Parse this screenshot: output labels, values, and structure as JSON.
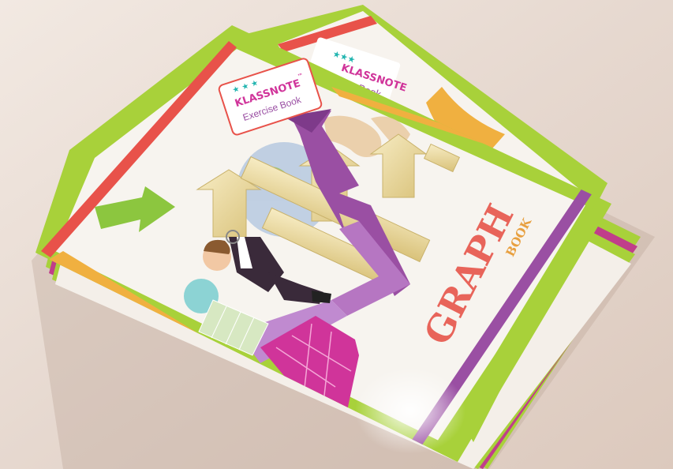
{
  "cover": {
    "brand": "KLASSNOTE",
    "brand_tm": "™",
    "product_line": "Exercise Book",
    "title": "GRAPH",
    "subtitle": "BOOK",
    "back_brand": "KLASSNOTE",
    "back_product_line": "Book"
  },
  "colors": {
    "table": "#e8ddd6",
    "lime": "#a8d13a",
    "red_stripe": "#e8524a",
    "orange": "#f0b040",
    "purple": "#9a4fa3",
    "magenta": "#d0349a",
    "title_red": "#e8645a",
    "title_gold": "#e8a040",
    "star_teal": "#22b5b0",
    "star_pink": "#e8508a"
  },
  "icons": [
    "star-icon",
    "arrow-right-icon",
    "zigzag-arrow-icon",
    "world-map-icon",
    "businessman-icon"
  ]
}
